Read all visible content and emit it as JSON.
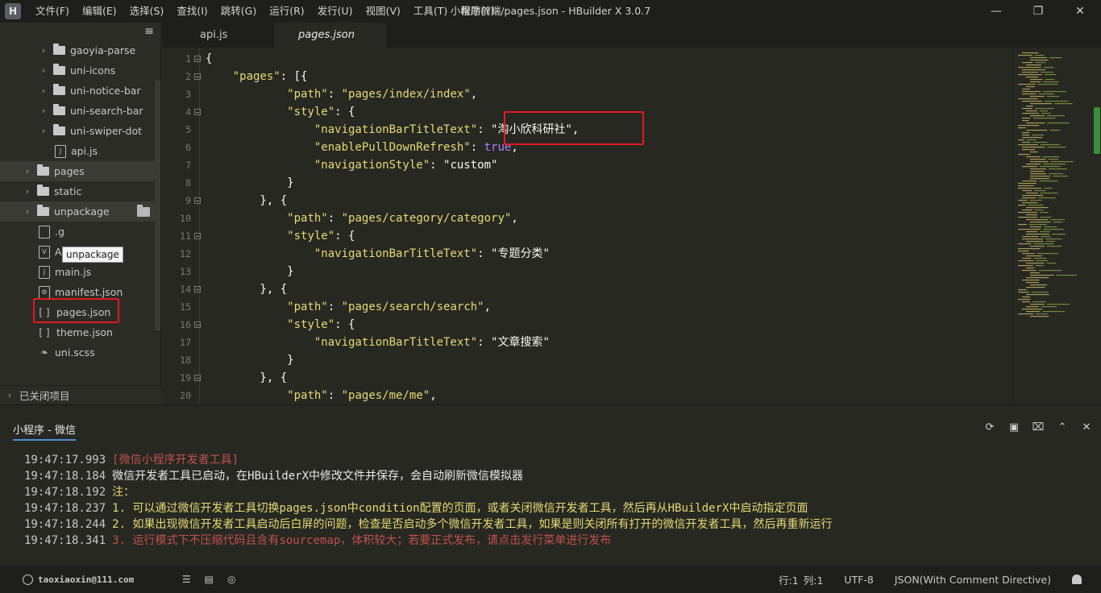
{
  "window": {
    "title": "小程序前端/pages.json - HBuilder X 3.0.7",
    "logo": "H"
  },
  "menu": [
    "文件(F)",
    "编辑(E)",
    "选择(S)",
    "查找(I)",
    "跳转(G)",
    "运行(R)",
    "发行(U)",
    "视图(V)",
    "工具(T)",
    "帮助(Y)"
  ],
  "sidebar": {
    "items": [
      {
        "label": "gaoyia-parse",
        "type": "folder"
      },
      {
        "label": "uni-icons",
        "type": "folder"
      },
      {
        "label": "uni-notice-bar",
        "type": "folder"
      },
      {
        "label": "uni-search-bar",
        "type": "folder"
      },
      {
        "label": "uni-swiper-dot",
        "type": "folder"
      },
      {
        "label": "api.js",
        "type": "file"
      },
      {
        "label": "pages",
        "type": "folder"
      },
      {
        "label": "static",
        "type": "folder"
      },
      {
        "label": "unpackage",
        "type": "folder"
      },
      {
        "label": ".g",
        "type": "file"
      },
      {
        "label": "App.vue",
        "type": "file"
      },
      {
        "label": "main.js",
        "type": "file"
      },
      {
        "label": "manifest.json",
        "type": "file"
      },
      {
        "label": "pages.json",
        "type": "file"
      },
      {
        "label": "theme.json",
        "type": "file"
      },
      {
        "label": "uni.scss",
        "type": "file"
      }
    ],
    "tooltip": "unpackage",
    "closed_projects": "已关闭项目"
  },
  "tabs": [
    {
      "label": "api.js",
      "active": false
    },
    {
      "label": "pages.json",
      "active": true
    }
  ],
  "editor": {
    "lines": [
      {
        "n": "1",
        "fold": true,
        "text": "{"
      },
      {
        "n": "2",
        "fold": true,
        "text": "    \"pages\": [{"
      },
      {
        "n": "3",
        "fold": false,
        "text": "            \"path\": \"pages/index/index\","
      },
      {
        "n": "4",
        "fold": true,
        "text": "            \"style\": {"
      },
      {
        "n": "5",
        "fold": false,
        "text": "                \"navigationBarTitleText\": \"淘小欣科研社\","
      },
      {
        "n": "6",
        "fold": false,
        "text": "                \"enablePullDownRefresh\": true,"
      },
      {
        "n": "7",
        "fold": false,
        "text": "                \"navigationStyle\": \"custom\""
      },
      {
        "n": "8",
        "fold": false,
        "text": "            }"
      },
      {
        "n": "9",
        "fold": true,
        "text": "        }, {"
      },
      {
        "n": "10",
        "fold": false,
        "text": "            \"path\": \"pages/category/category\","
      },
      {
        "n": "11",
        "fold": true,
        "text": "            \"style\": {"
      },
      {
        "n": "12",
        "fold": false,
        "text": "                \"navigationBarTitleText\": \"专题分类\""
      },
      {
        "n": "13",
        "fold": false,
        "text": "            }"
      },
      {
        "n": "14",
        "fold": true,
        "text": "        }, {"
      },
      {
        "n": "15",
        "fold": false,
        "text": "            \"path\": \"pages/search/search\","
      },
      {
        "n": "16",
        "fold": true,
        "text": "            \"style\": {"
      },
      {
        "n": "17",
        "fold": false,
        "text": "                \"navigationBarTitleText\": \"文章搜索\""
      },
      {
        "n": "18",
        "fold": false,
        "text": "            }"
      },
      {
        "n": "19",
        "fold": true,
        "text": "        }, {"
      },
      {
        "n": "20",
        "fold": false,
        "text": "            \"path\": \"pages/me/me\","
      }
    ]
  },
  "console": {
    "tab": "小程序 - 微信",
    "logs": [
      {
        "time": "19:47:17.993",
        "text": "[微信小程序开发者工具]",
        "color": "#c0504d"
      },
      {
        "time": "19:47:18.184",
        "text": "微信开发者工具已启动，在HBuilderX中修改文件并保存，会自动刷新微信模拟器",
        "color": "#e8e8e8"
      },
      {
        "time": "19:47:18.192",
        "text": "注：",
        "color": "#e6db74"
      },
      {
        "time": "19:47:18.237",
        "text": "1. 可以通过微信开发者工具切换pages.json中condition配置的页面，或者关闭微信开发者工具，然后再从HBuilderX中启动指定页面",
        "color": "#e6db74"
      },
      {
        "time": "19:47:18.244",
        "text": "2. 如果出现微信开发者工具启动后白屏的问题，检查是否启动多个微信开发者工具，如果是则关闭所有打开的微信开发者工具，然后再重新运行",
        "color": "#e6db74"
      },
      {
        "time": "19:47:18.341",
        "text": "3. 运行模式下不压缩代码且含有sourcemap，体积较大；若要正式发布，请点击发行菜单进行发布",
        "color": "#c0504d"
      }
    ]
  },
  "statusbar": {
    "user": "taoxiaoxin@111.com",
    "row": "行:1",
    "col": "列:1",
    "encoding": "UTF-8",
    "mode": "JSON(With Comment Directive)"
  },
  "colors": {
    "highlight_box": "#e4191e",
    "string": "#e6db74",
    "keyword": "#ae81ff"
  }
}
